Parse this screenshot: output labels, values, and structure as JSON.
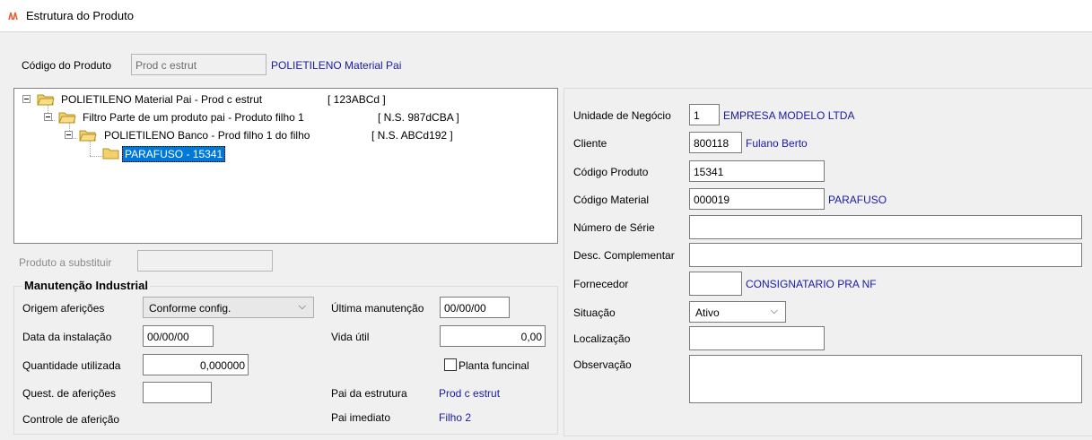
{
  "window": {
    "title": "Estrutura do Produto"
  },
  "header": {
    "codigo_label": "Código do Produto",
    "codigo_value": "Prod c estrut",
    "codigo_desc": "POLIETILENO Material Pai"
  },
  "tree": {
    "nodes": [
      {
        "label": "POLIETILENO Material Pai - Prod c estrut",
        "code": "[ 123ABCd ]"
      },
      {
        "label": "Filtro Parte de um produto pai - Produto filho 1",
        "code": "[ N.S. 987dCBA ]"
      },
      {
        "label": "POLIETILENO Banco - Prod filho 1 do filho",
        "code": "[ N.S. ABCd192 ]"
      },
      {
        "label": "PARAFUSO - 15341",
        "code": ""
      }
    ]
  },
  "substituir": {
    "label": "Produto a substituir",
    "value": ""
  },
  "manutencao": {
    "title": "Manutenção Industrial",
    "origem_label": "Origem aferições",
    "origem_value": "Conforme config.",
    "data_instalacao_label": "Data da instalação",
    "data_instalacao_value": "00/00/00",
    "quantidade_label": "Quantidade utilizada",
    "quantidade_value": "0,000000",
    "quest_label": "Quest. de aferições",
    "quest_value": "",
    "controle_label": "Controle de aferição",
    "ultima_label": "Última manutenção",
    "ultima_value": "00/00/00",
    "vida_label": "Vida útil",
    "vida_value": "0,00",
    "planta_label": "Planta funcinal",
    "pai_estrutura_label": "Pai da estrutura",
    "pai_estrutura_value": "Prod c estrut",
    "pai_imediato_label": "Pai imediato",
    "pai_imediato_value": "Filho 2"
  },
  "details": {
    "unidade_label": "Unidade de Negócio",
    "unidade_value": "1",
    "unidade_desc": "EMPRESA MODELO LTDA",
    "cliente_label": "Cliente",
    "cliente_value": "800118",
    "cliente_desc": "Fulano Berto",
    "codigo_produto_label": "Código Produto",
    "codigo_produto_value": "15341",
    "codigo_material_label": "Código Material",
    "codigo_material_value": "000019",
    "codigo_material_desc": "PARAFUSO",
    "numero_serie_label": "Número de Série",
    "numero_serie_value": "",
    "desc_label": "Desc. Complementar",
    "desc_value": "",
    "fornecedor_label": "Fornecedor",
    "fornecedor_value": "",
    "fornecedor_desc": "CONSIGNATARIO PRA NF",
    "situacao_label": "Situação",
    "situacao_value": "Ativo",
    "localizacao_label": "Localização",
    "localizacao_value": "",
    "observacao_label": "Observação",
    "observacao_value": ""
  },
  "colors": {
    "link_blue": "#1a1aa6",
    "selection": "#0078d7",
    "folder": "#f5c542"
  }
}
